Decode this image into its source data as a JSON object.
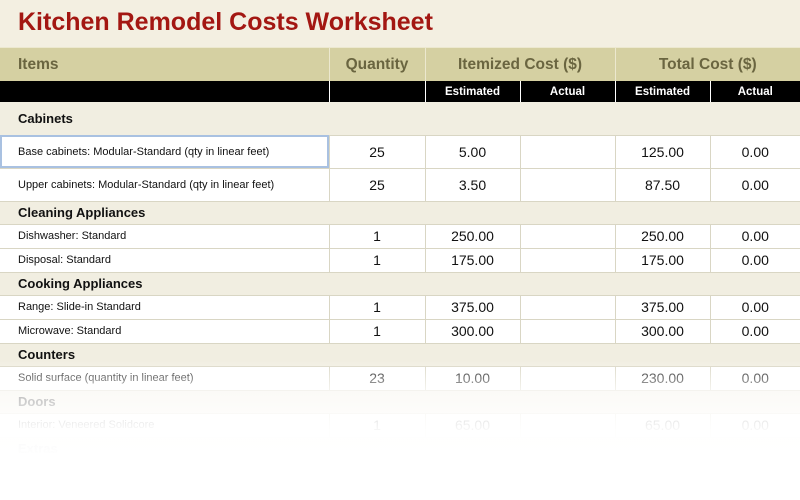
{
  "title": "Kitchen Remodel Costs Worksheet",
  "header": {
    "items": "Items",
    "quantity": "Quantity",
    "itemized_cost": "Itemized Cost ($)",
    "total_cost": "Total Cost ($)",
    "estimated": "Estimated",
    "actual": "Actual"
  },
  "rows": {
    "cabinets": {
      "label": "Cabinets"
    },
    "base_cabinets": {
      "label": "Base cabinets: Modular-Standard (qty in linear feet)",
      "qty": "25",
      "item_est": "5.00",
      "item_act": "",
      "total_est": "125.00",
      "total_act": "0.00"
    },
    "upper_cabinets": {
      "label": "Upper cabinets: Modular-Standard (qty in linear feet)",
      "qty": "25",
      "item_est": "3.50",
      "item_act": "",
      "total_est": "87.50",
      "total_act": "0.00"
    },
    "cleaning": {
      "label": "Cleaning Appliances"
    },
    "dishwasher": {
      "label": "Dishwasher: Standard",
      "qty": "1",
      "item_est": "250.00",
      "item_act": "",
      "total_est": "250.00",
      "total_act": "0.00"
    },
    "disposal": {
      "label": "Disposal: Standard",
      "qty": "1",
      "item_est": "175.00",
      "item_act": "",
      "total_est": "175.00",
      "total_act": "0.00"
    },
    "cooking": {
      "label": "Cooking Appliances"
    },
    "range": {
      "label": "Range: Slide-in Standard",
      "qty": "1",
      "item_est": "375.00",
      "item_act": "",
      "total_est": "375.00",
      "total_act": "0.00"
    },
    "microwave": {
      "label": "Microwave: Standard",
      "qty": "1",
      "item_est": "300.00",
      "item_act": "",
      "total_est": "300.00",
      "total_act": "0.00"
    },
    "counters": {
      "label": "Counters"
    },
    "solid_surface": {
      "label": "Solid surface (quantity in linear feet)",
      "qty": "23",
      "item_est": "10.00",
      "item_act": "",
      "total_est": "230.00",
      "total_act": "0.00"
    },
    "doors": {
      "label": "Doors"
    },
    "interior": {
      "label": "Interior: Veneered Solidcore",
      "qty": "1",
      "item_est": "65.00",
      "item_act": "",
      "total_est": "65.00",
      "total_act": "0.00"
    },
    "extras": {
      "label": "Extras"
    }
  }
}
